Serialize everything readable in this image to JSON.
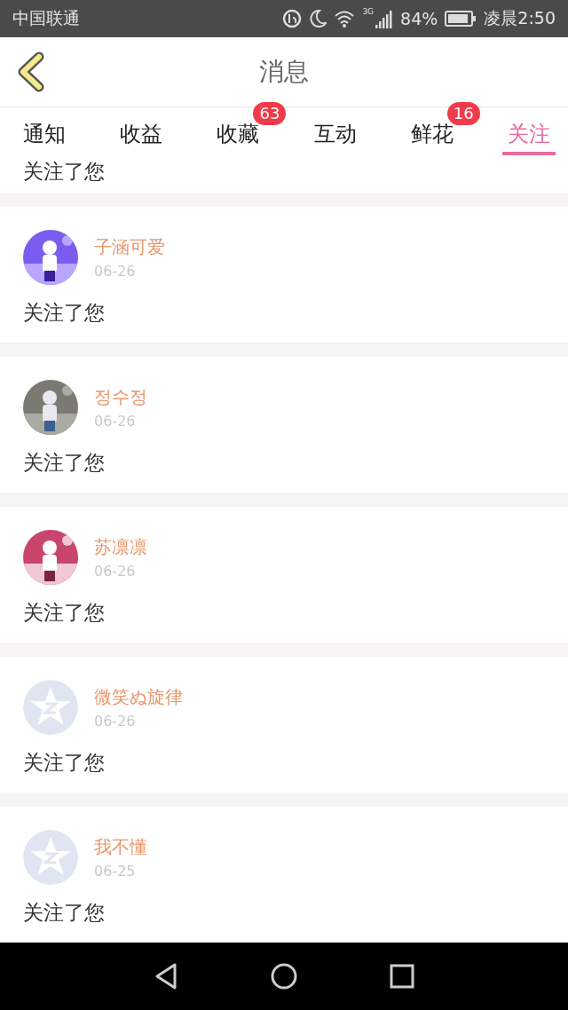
{
  "status_bar": {
    "carrier": "中国联通",
    "network": "3G",
    "battery": "84%",
    "time": "凌晨2:50"
  },
  "header": {
    "title": "消息"
  },
  "tabs": [
    {
      "label": "通知",
      "selected": false
    },
    {
      "label": "收益",
      "selected": false
    },
    {
      "label": "收藏",
      "selected": false,
      "badge": "63"
    },
    {
      "label": "互动",
      "selected": false
    },
    {
      "label": "鲜花",
      "selected": false,
      "badge": "16"
    },
    {
      "label": "关注",
      "selected": true
    }
  ],
  "partial_top": {
    "message": "关注了您"
  },
  "notifications": [
    {
      "name": "子涵可爱",
      "date": "06-26",
      "message": "关注了您",
      "kind": "picture"
    },
    {
      "name": "정수정",
      "date": "06-26",
      "message": "关注了您",
      "kind": "picture"
    },
    {
      "name": "苏凛凛",
      "date": "06-26",
      "message": "关注了您",
      "kind": "picture"
    },
    {
      "name": "微笑ぬ旋律",
      "date": "06-26",
      "message": "关注了您",
      "kind": "default"
    },
    {
      "name": "我不懂",
      "date": "06-25",
      "message": "关注了您",
      "kind": "default"
    }
  ]
}
